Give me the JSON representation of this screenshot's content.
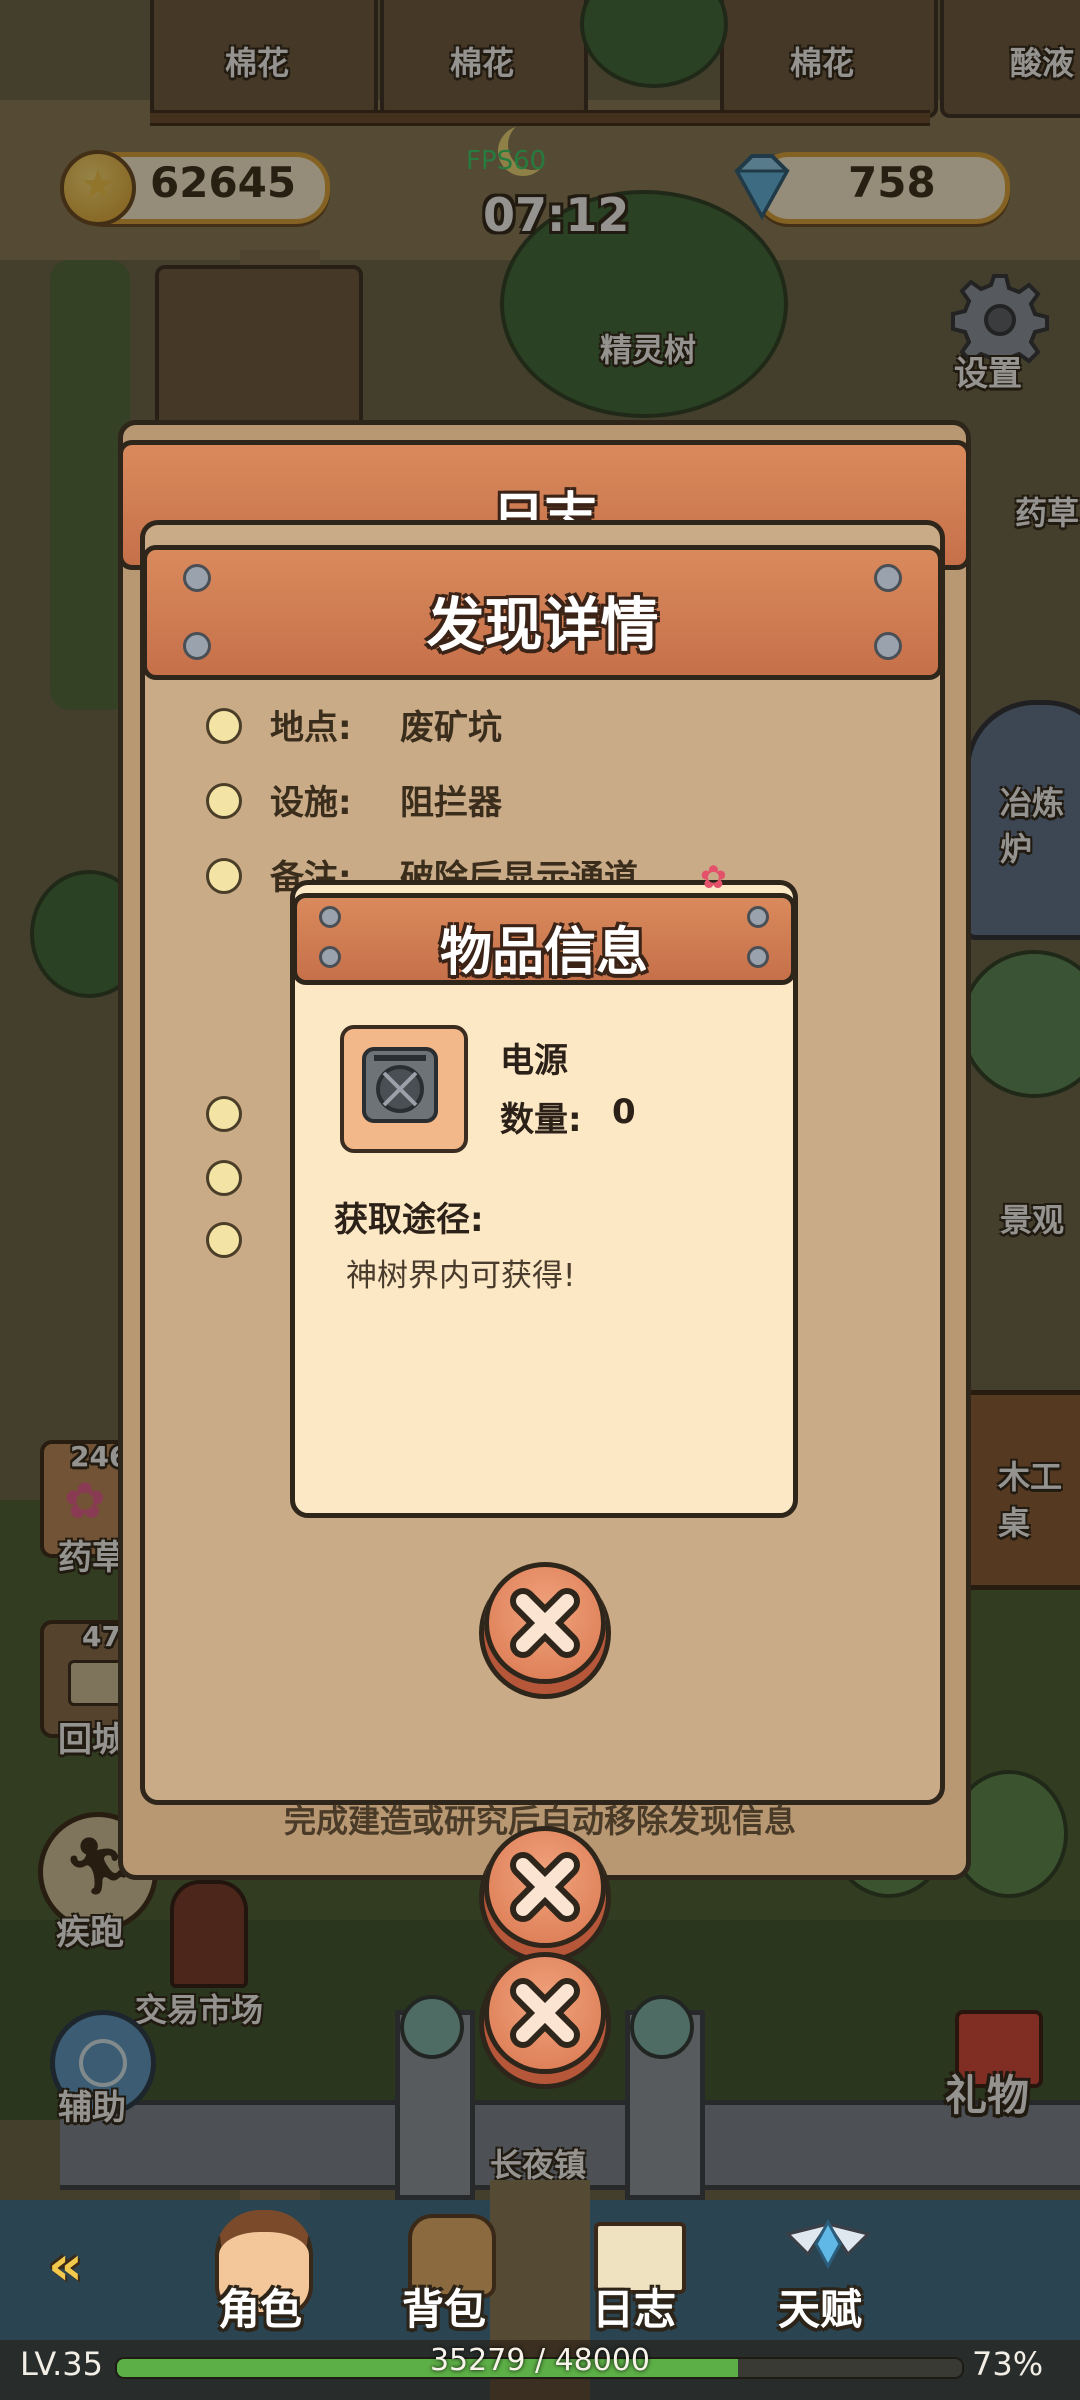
{
  "hud": {
    "fps": "FPS60",
    "time": "07:12",
    "coins": "62645",
    "gems": "758"
  },
  "world_labels": {
    "cotton1": "棉花",
    "cotton2": "棉花",
    "cotton3": "棉花",
    "acid": "酸液",
    "spirit_tree": "精灵树",
    "settings": "设置",
    "herb_right": "药草",
    "smelter": "冶炼炉",
    "scenery": "景观",
    "workbench": "木工桌",
    "market": "交易市场",
    "town": "长夜镇"
  },
  "side_buttons": {
    "herb_count": "246",
    "herb_label": "药草",
    "return_count": "47",
    "return_label": "回城",
    "sprint_label": "疾跑",
    "assist_label": "辅助",
    "gift_label": "礼物"
  },
  "journal_panel": {
    "title": "日志"
  },
  "discovery_panel": {
    "title": "发现详情",
    "rows": [
      {
        "label": "地点:",
        "value": "废矿坑"
      },
      {
        "label": "设施:",
        "value": "阻拦器"
      },
      {
        "label": "备注:",
        "value": "破除后显示通道"
      }
    ],
    "footer": "完成建造或研究后自动移除发现信息"
  },
  "item_popup": {
    "title": "物品信息",
    "item_name": "电源",
    "quantity_label": "数量:",
    "quantity_value": "0",
    "source_title": "获取途径:",
    "source_text": "神树界内可获得!"
  },
  "bottom_nav": {
    "character": "角色",
    "backpack": "背包",
    "journal": "日志",
    "talent": "天赋"
  },
  "status_bar": {
    "level": "LV.35",
    "xp": "35279 / 48000",
    "xp_progress": 0.735,
    "battery": "73%"
  },
  "colors": {
    "accent_orange": "#d9774f",
    "panel_tan": "#c9ab87",
    "popup_cream": "#fde8c6",
    "xp_green": "#4f9a3a"
  }
}
